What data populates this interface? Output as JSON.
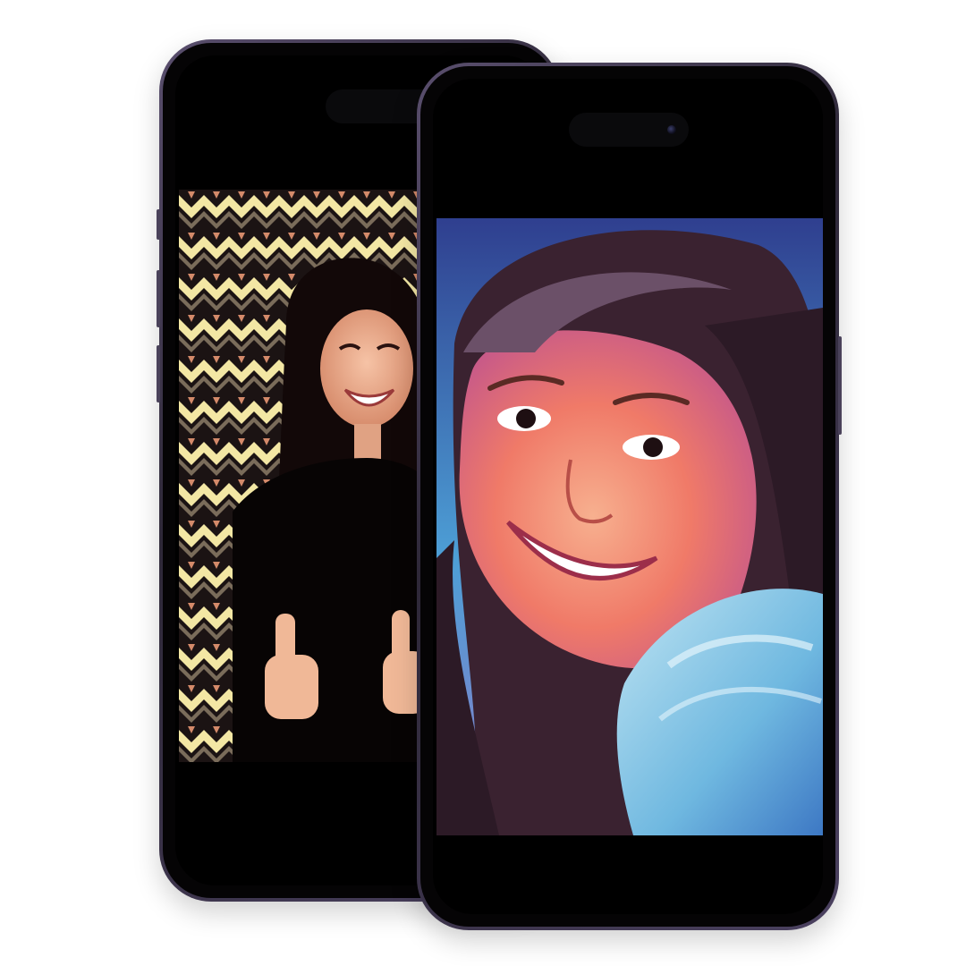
{
  "scene": {
    "background_color": "#ffffff",
    "frame_color": "#3a3148"
  },
  "phones": [
    {
      "id": "back",
      "image": {
        "description_icon": "portrait-photo-icon",
        "palette": [
          "#f3e7a4",
          "#1b1313",
          "#d48a6a",
          "#050303"
        ]
      }
    },
    {
      "id": "front",
      "image": {
        "description_icon": "painted-portrait-icon",
        "palette": [
          "#3b5aa8",
          "#7cc7e6",
          "#f27a5c",
          "#3a2230"
        ]
      }
    }
  ]
}
